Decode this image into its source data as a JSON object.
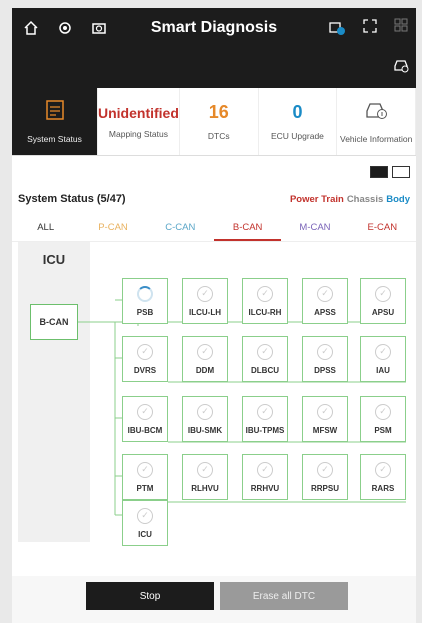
{
  "header": {
    "title": "Smart Diagnosis",
    "left_icons": [
      "home-icon",
      "settings-gear-icon",
      "camera-icon"
    ],
    "right_icons": [
      "vehicle-info-icon",
      "fullscreen-icon",
      "grid-icon"
    ]
  },
  "summary": {
    "system_status_label": "System Status",
    "mapping_status_value": "Unidentified",
    "mapping_status_label": "Mapping Status",
    "dtcs_value": "16",
    "dtcs_label": "DTCs",
    "ecu_upgrade_value": "0",
    "ecu_upgrade_label": "ECU Upgrade",
    "vehicle_info_label": "Vehicle Information"
  },
  "main": {
    "status_title": "System Status (5/47)",
    "legend_powertrain": "Power Train",
    "legend_chassis": "Chassis",
    "legend_body": "Body",
    "tabs": [
      "ALL",
      "P-CAN",
      "C-CAN",
      "B-CAN",
      "M-CAN",
      "E-CAN"
    ],
    "active_tab": "B-CAN",
    "panel_title": "ICU",
    "bus_label": "B-CAN",
    "ecus_row1": [
      "PSB",
      "ILCU-LH",
      "ILCU-RH",
      "APSS",
      "APSU"
    ],
    "ecus_row2": [
      "DVRS",
      "DDM",
      "DLBCU",
      "DPSS",
      "IAU"
    ],
    "ecus_row3": [
      "IBU-BCM",
      "IBU-SMK",
      "IBU-TPMS",
      "MFSW",
      "PSM"
    ],
    "ecus_row4": [
      "PTM",
      "RLHVU",
      "RRHVU",
      "RRPSU",
      "RARS"
    ],
    "ecus_row5": [
      "ICU"
    ],
    "loading_ecu": "PSB"
  },
  "bottom": {
    "stop_label": "Stop",
    "erase_label": "Erase all DTC"
  },
  "colors": {
    "accent_red": "#c2322c",
    "accent_orange": "#e6892a",
    "accent_blue": "#1a8bc6",
    "ecu_border_green": "#8bcf8b"
  }
}
